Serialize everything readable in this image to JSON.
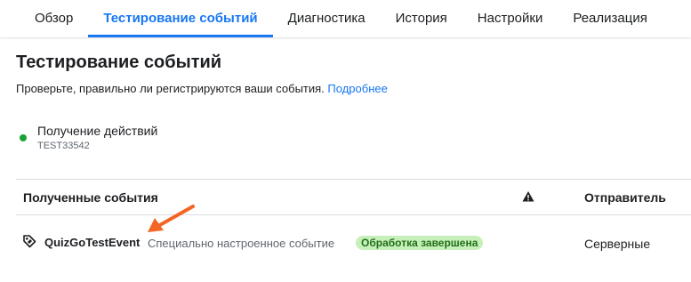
{
  "tabs": [
    {
      "label": "Обзор",
      "active": false
    },
    {
      "label": "Тестирование событий",
      "active": true
    },
    {
      "label": "Диагностика",
      "active": false
    },
    {
      "label": "История",
      "active": false
    },
    {
      "label": "Настройки",
      "active": false
    },
    {
      "label": "Реализация",
      "active": false
    }
  ],
  "page": {
    "title": "Тестирование событий",
    "subtitle": "Проверьте, правильно ли регистрируются ваши события.",
    "more_link": "Подробнее"
  },
  "status": {
    "label": "Получение действий",
    "code": "TEST33542",
    "color": "#1aa332"
  },
  "table": {
    "headers": {
      "events": "Полученные события",
      "sender": "Отправитель"
    },
    "rows": [
      {
        "name": "QuizGoTestEvent",
        "description": "Специально настроенное событие",
        "badge": "Обработка завершена",
        "sender": "Серверные"
      }
    ]
  },
  "colors": {
    "accent": "#1877f2",
    "badge_bg": "#c7efb9",
    "badge_text": "#21701a",
    "annotation_arrow": "#f26522"
  }
}
